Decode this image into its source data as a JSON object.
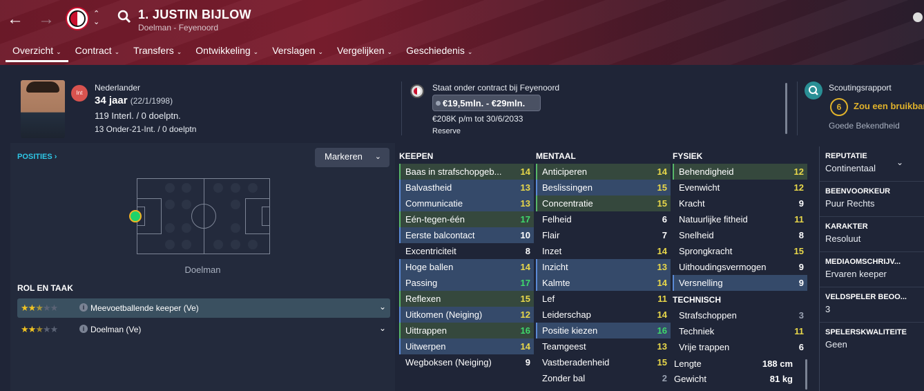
{
  "header": {
    "player_name": "1. JUSTIN BIJLOW",
    "subtitle": "Doelman - Feyenoord",
    "tabs": [
      "Overzicht",
      "Contract",
      "Transfers",
      "Ontwikkeling",
      "Verslagen",
      "Vergelijken",
      "Geschiedenis"
    ]
  },
  "profile": {
    "int_badge": "Int",
    "nationality": "Nederlander",
    "age": "34 jaar",
    "dob": "(22/1/1998)",
    "caps": "119 Interl. / 0 doelptn.",
    "u21": "13 Onder-21-Int. / 0 doelptn"
  },
  "contract": {
    "status": "Staat onder contract bij Feyenoord",
    "value": "€19,5mln. - €29mln.",
    "wage": "€208K p/m tot 30/6/2033",
    "squad": "Reserve"
  },
  "scouting": {
    "title": "Scoutingsrapport",
    "score": "6",
    "verdict": "Zou een bruikbar",
    "knowledge": "Goede Bekendheid"
  },
  "positions": {
    "title": "POSITIES",
    "markeren": "Markeren",
    "label": "Doelman",
    "role_title": "ROL EN TAAK",
    "roles": [
      {
        "name": "Meevoetballende keeper (Ve)",
        "stars": 2.5
      },
      {
        "name": "Doelman (Ve)",
        "stars": 2.5
      }
    ]
  },
  "attributes": {
    "keepen": {
      "title": "KEEPEN",
      "rows": [
        {
          "name": "Baas in strafschopgeb...",
          "value": "14"
        },
        {
          "name": "Balvastheid",
          "value": "13"
        },
        {
          "name": "Communicatie",
          "value": "13"
        },
        {
          "name": "Eén-tegen-één",
          "value": "17"
        },
        {
          "name": "Eerste balcontact",
          "value": "10"
        },
        {
          "name": "Excentriciteit",
          "value": "8"
        },
        {
          "name": "Hoge ballen",
          "value": "14"
        },
        {
          "name": "Passing",
          "value": "17"
        },
        {
          "name": "Reflexen",
          "value": "15"
        },
        {
          "name": "Uitkomen (Neiging)",
          "value": "12"
        },
        {
          "name": "Uittrappen",
          "value": "16"
        },
        {
          "name": "Uitwerpen",
          "value": "14"
        },
        {
          "name": "Wegboksen (Neiging)",
          "value": "9"
        }
      ]
    },
    "mentaal": {
      "title": "MENTAAL",
      "rows": [
        {
          "name": "Anticiperen",
          "value": "14"
        },
        {
          "name": "Beslissingen",
          "value": "15"
        },
        {
          "name": "Concentratie",
          "value": "15"
        },
        {
          "name": "Felheid",
          "value": "6"
        },
        {
          "name": "Flair",
          "value": "7"
        },
        {
          "name": "Inzet",
          "value": "14"
        },
        {
          "name": "Inzicht",
          "value": "13"
        },
        {
          "name": "Kalmte",
          "value": "14"
        },
        {
          "name": "Lef",
          "value": "11"
        },
        {
          "name": "Leiderschap",
          "value": "14"
        },
        {
          "name": "Positie kiezen",
          "value": "16"
        },
        {
          "name": "Teamgeest",
          "value": "13"
        },
        {
          "name": "Vastberadenheid",
          "value": "15"
        },
        {
          "name": "Zonder bal",
          "value": "2"
        }
      ]
    },
    "fysiek": {
      "title": "FYSIEK",
      "rows": [
        {
          "name": "Behendigheid",
          "value": "12"
        },
        {
          "name": "Evenwicht",
          "value": "12"
        },
        {
          "name": "Kracht",
          "value": "9"
        },
        {
          "name": "Natuurlijke fitheid",
          "value": "11"
        },
        {
          "name": "Snelheid",
          "value": "8"
        },
        {
          "name": "Sprongkracht",
          "value": "15"
        },
        {
          "name": "Uithoudingsvermogen",
          "value": "9"
        },
        {
          "name": "Versnelling",
          "value": "9"
        }
      ]
    },
    "technisch": {
      "title": "TECHNISCH",
      "rows": [
        {
          "name": "Strafschoppen",
          "value": "3"
        },
        {
          "name": "Techniek",
          "value": "11"
        },
        {
          "name": "Vrije trappen",
          "value": "6"
        }
      ]
    },
    "body": {
      "length_label": "Lengte",
      "length": "188 cm",
      "weight_label": "Gewicht",
      "weight": "81 kg"
    }
  },
  "details": [
    {
      "key": "REPUTATIE",
      "value": "Continentaal"
    },
    {
      "key": "BEENVOORKEUR",
      "value": "Puur Rechts"
    },
    {
      "key": "KARAKTER",
      "value": "Resoluut"
    },
    {
      "key": "MEDIAOMSCHRIJV...",
      "value": "Ervaren keeper"
    },
    {
      "key": "VELDSPELER BEOO...",
      "value": "3"
    },
    {
      "key": "SPELERSKWALITEITE",
      "value": "Geen"
    }
  ],
  "colors": {
    "header_accent": "#7a1d2e",
    "highlight_blue": "#354a6a",
    "highlight_green": "#35483d",
    "value_yellow": "#e9d84a",
    "value_green": "#3fd96b",
    "scout_gold": "#e0b22b"
  }
}
